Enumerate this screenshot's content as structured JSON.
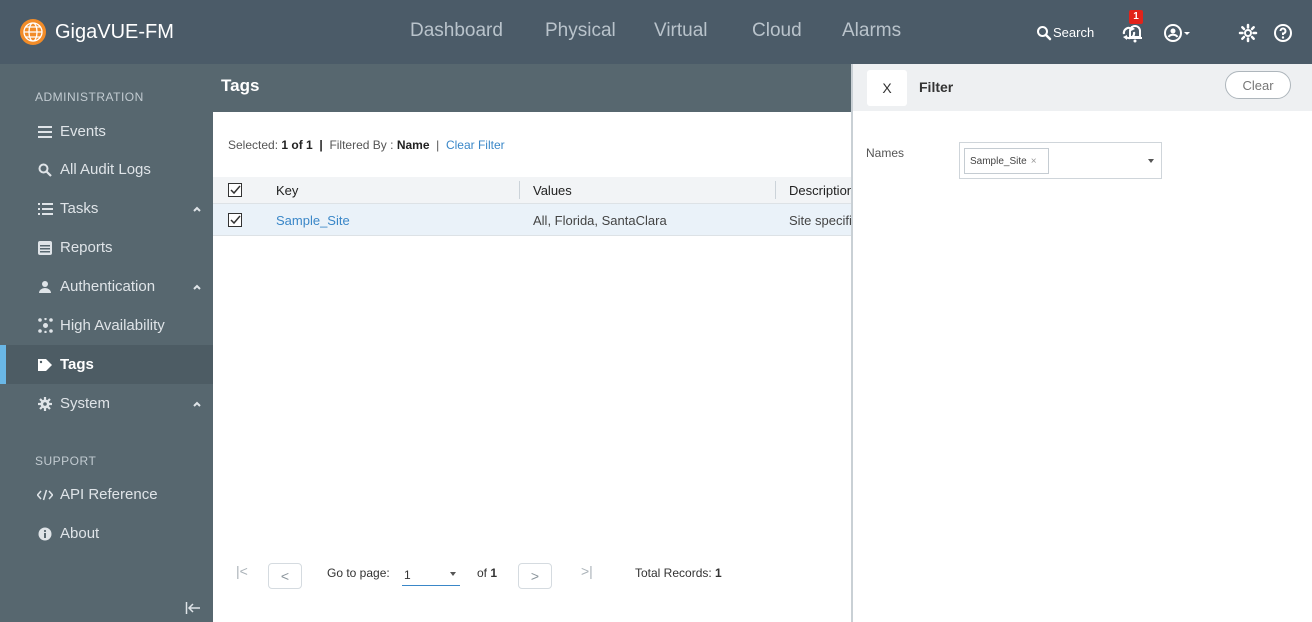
{
  "app": {
    "name": "GigaVUE-FM"
  },
  "nav": [
    "Dashboard",
    "Physical",
    "Virtual",
    "Cloud",
    "Alarms"
  ],
  "topbar": {
    "search_label": "Search",
    "notification_count": "1"
  },
  "sidebar": {
    "section_admin": "ADMINISTRATION",
    "section_support": "SUPPORT",
    "items": [
      {
        "label": "Events",
        "icon": "list-icon"
      },
      {
        "label": "All Audit Logs",
        "icon": "search-icon"
      },
      {
        "label": "Tasks",
        "icon": "tasks-icon"
      },
      {
        "label": "Reports",
        "icon": "reports-icon"
      },
      {
        "label": "Authentication",
        "icon": "user-icon"
      },
      {
        "label": "High Availability",
        "icon": "cluster-icon"
      },
      {
        "label": "Tags",
        "icon": "tag-icon",
        "active": true
      },
      {
        "label": "System",
        "icon": "gear-icon"
      }
    ],
    "support_items": [
      {
        "label": "API Reference",
        "icon": "code-icon"
      },
      {
        "label": "About",
        "icon": "info-icon"
      }
    ]
  },
  "page": {
    "title": "Tags",
    "selected_prefix": "Selected:",
    "selected_value": "1 of 1",
    "filtered_by_prefix": "Filtered By :",
    "filtered_by_value": "Name",
    "clear_filter": "Clear Filter"
  },
  "table": {
    "columns": [
      "Key",
      "Values",
      "Description"
    ],
    "rows": [
      {
        "key": "Sample_Site",
        "values": "All, Florida, SantaClara",
        "description": "Site specifi"
      }
    ]
  },
  "pagination": {
    "goto_label": "Go to page:",
    "current_page": "1",
    "of_label": "of",
    "total_pages": "1",
    "total_label": "Total Records:",
    "total_records": "1"
  },
  "filter": {
    "close_label": "X",
    "title": "Filter",
    "clear_label": "Clear",
    "names_label": "Names",
    "names_selected": "Sample_Site",
    "chip_remove": "×"
  },
  "colors": {
    "topbar": "#4b5b68",
    "sidebar": "#57676f",
    "accent": "#6ab7e6",
    "link": "#3a87c8",
    "logo": "#f28c28"
  }
}
